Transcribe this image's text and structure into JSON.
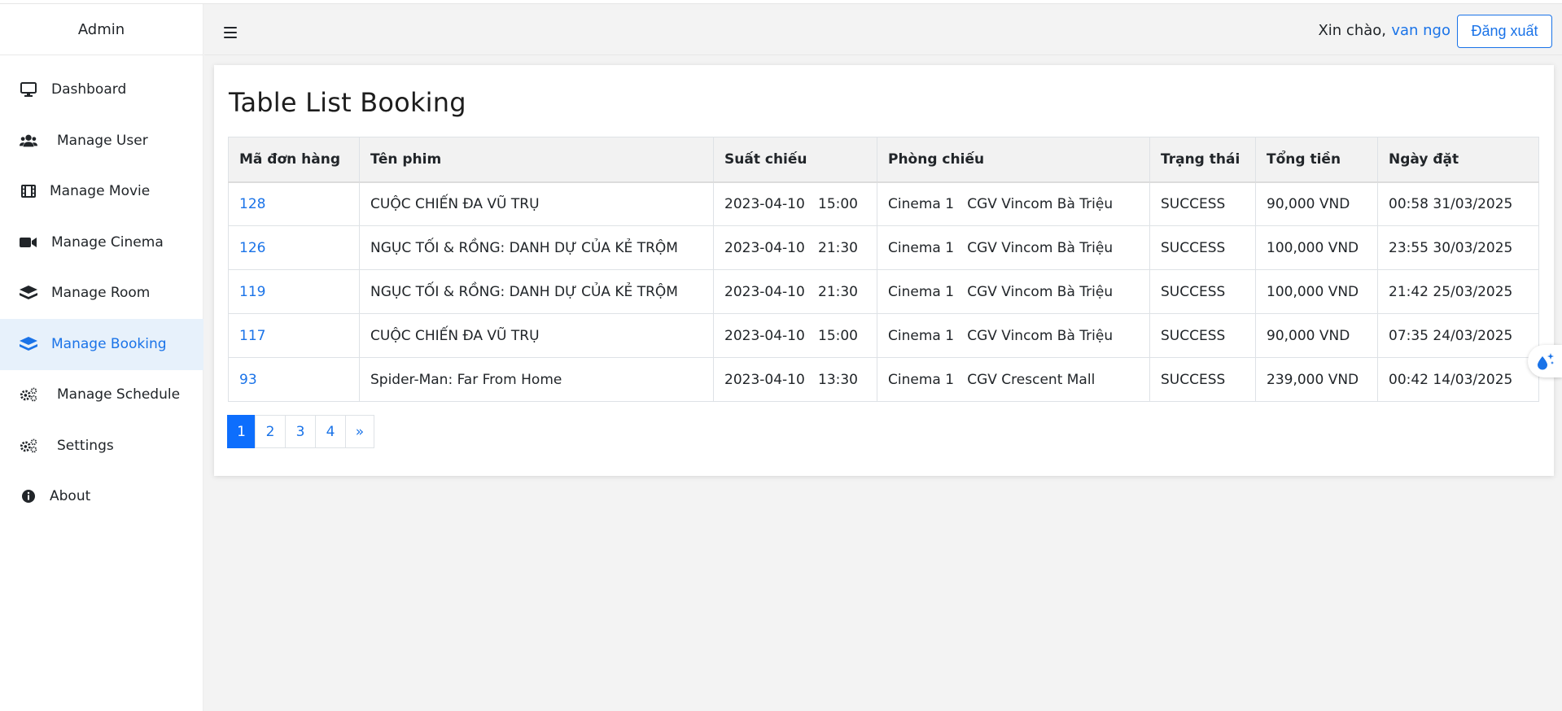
{
  "brand": "Admin",
  "sidebar": {
    "items": [
      {
        "label": "Dashboard",
        "icon": "monitor-icon"
      },
      {
        "label": "Manage User",
        "icon": "users-icon"
      },
      {
        "label": "Manage Movie",
        "icon": "film-icon"
      },
      {
        "label": "Manage Cinema",
        "icon": "video-camera-icon"
      },
      {
        "label": "Manage Room",
        "icon": "layers-icon"
      },
      {
        "label": "Manage Booking",
        "icon": "layers-icon",
        "active": true
      },
      {
        "label": "Manage Schedule",
        "icon": "gears-icon"
      },
      {
        "label": "Settings",
        "icon": "gears-icon"
      },
      {
        "label": "About",
        "icon": "info-circle-icon"
      }
    ]
  },
  "header": {
    "greeting": "Xin chào,",
    "username": "van ngo",
    "logout_label": "Đăng xuất"
  },
  "main": {
    "title": "Table List Booking",
    "columns": [
      "Mã đơn hàng",
      "Tên phim",
      "Suất chiếu",
      "Phòng chiếu",
      "Trạng thái",
      "Tổng tiền",
      "Ngày đặt"
    ],
    "rows": [
      {
        "id": "128",
        "movie": "CUỘC CHIẾN ĐA VŨ TRỤ",
        "showtime": "2023-04-10   15:00",
        "room": "Cinema 1   CGV Vincom Bà Triệu",
        "status": "SUCCESS",
        "total": "90,000 VND",
        "date": "00:58 31/03/2025"
      },
      {
        "id": "126",
        "movie": "NGỤC TỐI & RỒNG: DANH DỰ CỦA KẺ TRỘM",
        "showtime": "2023-04-10   21:30",
        "room": "Cinema 1   CGV Vincom Bà Triệu",
        "status": "SUCCESS",
        "total": "100,000 VND",
        "date": "23:55 30/03/2025"
      },
      {
        "id": "119",
        "movie": "NGỤC TỐI & RỒNG: DANH DỰ CỦA KẺ TRỘM",
        "showtime": "2023-04-10   21:30",
        "room": "Cinema 1   CGV Vincom Bà Triệu",
        "status": "SUCCESS",
        "total": "100,000 VND",
        "date": "21:42 25/03/2025"
      },
      {
        "id": "117",
        "movie": "CUỘC CHIẾN ĐA VŨ TRỤ",
        "showtime": "2023-04-10   15:00",
        "room": "Cinema 1   CGV Vincom Bà Triệu",
        "status": "SUCCESS",
        "total": "90,000 VND",
        "date": "07:35 24/03/2025"
      },
      {
        "id": "93",
        "movie": "Spider-Man: Far From Home",
        "showtime": "2023-04-10   13:30",
        "room": "Cinema 1   CGV Crescent Mall",
        "status": "SUCCESS",
        "total": "239,000 VND",
        "date": "00:42 14/03/2025"
      }
    ],
    "pagination": [
      "1",
      "2",
      "3",
      "4",
      "»"
    ],
    "current_page": "1"
  },
  "colors": {
    "accent": "#1a73e8",
    "active_page": "#0d6efd",
    "active_sidebar_bg": "#e7f1fb"
  },
  "float_widget_icon": "water-drop-sparkle-icon"
}
